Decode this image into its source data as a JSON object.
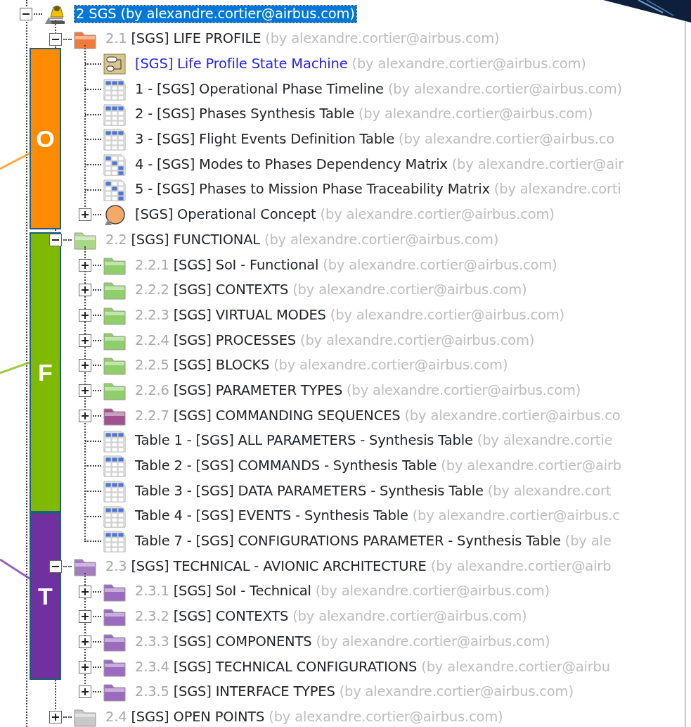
{
  "tree": [
    {
      "kind": "user-package",
      "name": "2 SGS",
      "author": "(by alexandre.cortier@airbus.com)",
      "selected": true,
      "expanded": true,
      "children": [
        {
          "kind": "folder",
          "color": "#f07a3c",
          "number": "2.1",
          "name": "[SGS] LIFE PROFILE",
          "author": "(by alexandre.cortier@airbus.com)",
          "selected": false,
          "expanded": true,
          "children": [
            {
              "kind": "state-machine",
              "name": "[SGS] Life Profile State Machine",
              "author": "(by alexandre.cortier@airbus.com)",
              "selected": false
            },
            {
              "kind": "table",
              "name": "1 - [SGS] Operational Phase Timeline",
              "author": "(by alexandre.cortier@airbus.com)",
              "selected": false
            },
            {
              "kind": "table",
              "name": "2 - [SGS] Phases Synthesis Table",
              "author": "(by alexandre.cortier@airbus.com)",
              "selected": false
            },
            {
              "kind": "table",
              "name": "3 - [SGS] Flight Events Definition Table",
              "author": "(by alexandre.cortier@airbus.co",
              "selected": false
            },
            {
              "kind": "matrix",
              "name": "4 - [SGS] Modes to Phases Dependency Matrix",
              "author": "(by alexandre.cortier@air",
              "selected": false
            },
            {
              "kind": "matrix",
              "name": "5 - [SGS] Phases to Mission Phase Traceability Matrix",
              "author": "(by alexandre.corti",
              "selected": false
            },
            {
              "kind": "concept",
              "name": "[SGS] Operational Concept",
              "author": "(by alexandre.cortier@airbus.com)",
              "selected": false,
              "expanded": false
            }
          ]
        },
        {
          "kind": "folder",
          "color": "#a9d88a",
          "number": "2.2",
          "name": "[SGS] FUNCTIONAL",
          "author": "(by alexandre.cortier@airbus.com)",
          "selected": false,
          "expanded": true,
          "children": [
            {
              "kind": "folder",
              "color": "#8fcf6a",
              "number": "2.2.1",
              "name": "[SGS] SoI - Functional",
              "author": "(by alexandre.cortier@airbus.com)",
              "selected": false,
              "expanded": false
            },
            {
              "kind": "folder",
              "color": "#8fcf6a",
              "number": "2.2.2",
              "name": "[SGS] CONTEXTS",
              "author": "(by alexandre.cortier@airbus.com)",
              "selected": false,
              "expanded": false
            },
            {
              "kind": "folder",
              "color": "#8fcf6a",
              "number": "2.2.3",
              "name": "[SGS] VIRTUAL MODES",
              "author": "(by alexandre.cortier@airbus.com)",
              "selected": false,
              "expanded": false
            },
            {
              "kind": "folder",
              "color": "#8fcf6a",
              "number": "2.2.4",
              "name": "[SGS] PROCESSES",
              "author": "(by alexandre.cortier@airbus.com)",
              "selected": false,
              "expanded": false
            },
            {
              "kind": "folder",
              "color": "#8fcf6a",
              "number": "2.2.5",
              "name": "[SGS] BLOCKS",
              "author": "(by alexandre.cortier@airbus.com)",
              "selected": false,
              "expanded": false
            },
            {
              "kind": "folder",
              "color": "#8fcf6a",
              "number": "2.2.6",
              "name": "[SGS] PARAMETER TYPES",
              "author": "(by alexandre.cortier@airbus.com)",
              "selected": false,
              "expanded": false
            },
            {
              "kind": "folder",
              "color": "#a3508f",
              "number": "2.2.7",
              "name": "[SGS] COMMANDING SEQUENCES",
              "author": "(by alexandre.cortier@airbus.co",
              "selected": false,
              "expanded": false
            },
            {
              "kind": "table",
              "name": "Table 1 - [SGS] ALL PARAMETERS -  Synthesis Table",
              "author": "(by alexandre.cortie",
              "selected": false
            },
            {
              "kind": "table",
              "name": "Table 2 - [SGS] COMMANDS - Synthesis Table",
              "author": "(by alexandre.cortier@airb",
              "selected": false
            },
            {
              "kind": "table",
              "name": "Table 3 - [SGS] DATA PARAMETERS - Synthesis Table",
              "author": "(by alexandre.cort",
              "selected": false
            },
            {
              "kind": "table",
              "name": "Table 4 - [SGS] EVENTS - Synthesis Table",
              "author": "(by alexandre.cortier@airbus.c",
              "selected": false
            },
            {
              "kind": "table",
              "name": "Table 7 - [SGS] CONFIGURATIONS PARAMETER - Synthesis Table",
              "author": "(by ale",
              "selected": false
            }
          ]
        },
        {
          "kind": "folder",
          "color": "#a57cc4",
          "number": "2.3",
          "name": "[SGS] TECHNICAL - AVIONIC ARCHITECTURE",
          "author": "(by alexandre.cortier@airb",
          "selected": false,
          "expanded": true,
          "children": [
            {
              "kind": "folder",
              "color": "#9a6cc0",
              "number": "2.3.1",
              "name": "[SGS] SoI - Technical",
              "author": "(by alexandre.cortier@airbus.com)",
              "selected": false,
              "expanded": false
            },
            {
              "kind": "folder",
              "color": "#9a6cc0",
              "number": "2.3.2",
              "name": "[SGS] CONTEXTS",
              "author": "(by alexandre.cortier@airbus.com)",
              "selected": false,
              "expanded": false
            },
            {
              "kind": "folder",
              "color": "#9a6cc0",
              "number": "2.3.3",
              "name": "[SGS] COMPONENTS",
              "author": "(by alexandre.cortier@airbus.com)",
              "selected": false,
              "expanded": false
            },
            {
              "kind": "folder",
              "color": "#9a6cc0",
              "number": "2.3.4",
              "name": "[SGS] TECHNICAL CONFIGURATIONS",
              "author": "(by alexandre.cortier@airbu",
              "selected": false,
              "expanded": false
            },
            {
              "kind": "folder",
              "color": "#9a6cc0",
              "number": "2.3.5",
              "name": "[SGS] INTERFACE TYPES",
              "author": "(by alexandre.cortier@airbus.com)",
              "selected": false,
              "expanded": false
            }
          ]
        },
        {
          "kind": "folder",
          "color": "#c8c8c8",
          "number": "2.4",
          "name": "[SGS] OPEN POINTS",
          "author": "(by alexandre.cortier@airbus.com)",
          "selected": false,
          "expanded": false
        }
      ]
    }
  ],
  "phase_markers": [
    {
      "label": "O",
      "color": "#ff8c00"
    },
    {
      "label": "F",
      "color": "#7fba00"
    },
    {
      "label": "T",
      "color": "#7030a0"
    }
  ]
}
